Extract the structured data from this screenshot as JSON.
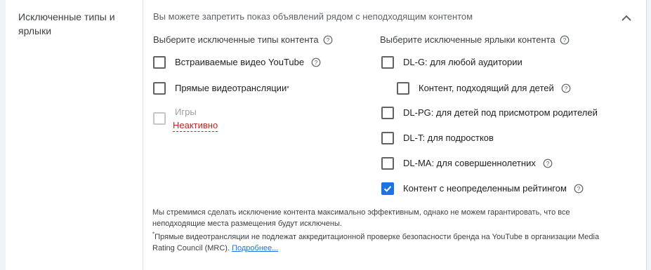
{
  "section": {
    "title": "Исключенные типы и ярлыки",
    "summary": "Вы можете запретить показ объявлений рядом с неподходящим контентом"
  },
  "icons": {
    "collapse": "chevron-up-icon",
    "help": "help-circle-icon",
    "check": "check-icon"
  },
  "left_column": {
    "heading": "Выберите исключенные типы контента",
    "options": [
      {
        "label": "Встраиваемые видео YouTube",
        "checked": false,
        "has_help": true
      },
      {
        "label": "Прямые видеотрансляции",
        "marker": "*",
        "checked": false
      },
      {
        "label": "Игры",
        "checked": false,
        "disabled": true,
        "status": "Неактивно"
      }
    ]
  },
  "right_column": {
    "heading": "Выберите исключенные ярлыки контента",
    "options": [
      {
        "label": "DL-G: для любой аудитории",
        "checked": false
      },
      {
        "label": "Контент, подходящий для детей",
        "checked": false,
        "has_help": true,
        "nested": true
      },
      {
        "label": "DL-PG: для детей под присмотром родителей",
        "checked": false
      },
      {
        "label": "DL-T: для подростков",
        "checked": false
      },
      {
        "label": "DL-MA: для совершеннолетних",
        "checked": false,
        "has_help": true
      },
      {
        "label": "Контент с неопределенным рейтингом",
        "checked": true,
        "has_help": true
      }
    ]
  },
  "footnotes": {
    "disclaimer": "Мы стремимся сделать исключение контента максимально эффективным, однако не можем гарантировать, что все неподходящие места размещения будут исключены.",
    "marker": "*",
    "live_note": "Прямые видеотрансляции не подлежат аккредитационной проверке безопасности бренда на YouTube в организации Media Rating Council (MRC).",
    "link_text": "Подробнее..."
  },
  "colors": {
    "accent": "#1a73e8",
    "inactive": "#c5221f",
    "muted_text": "#5f6368"
  }
}
